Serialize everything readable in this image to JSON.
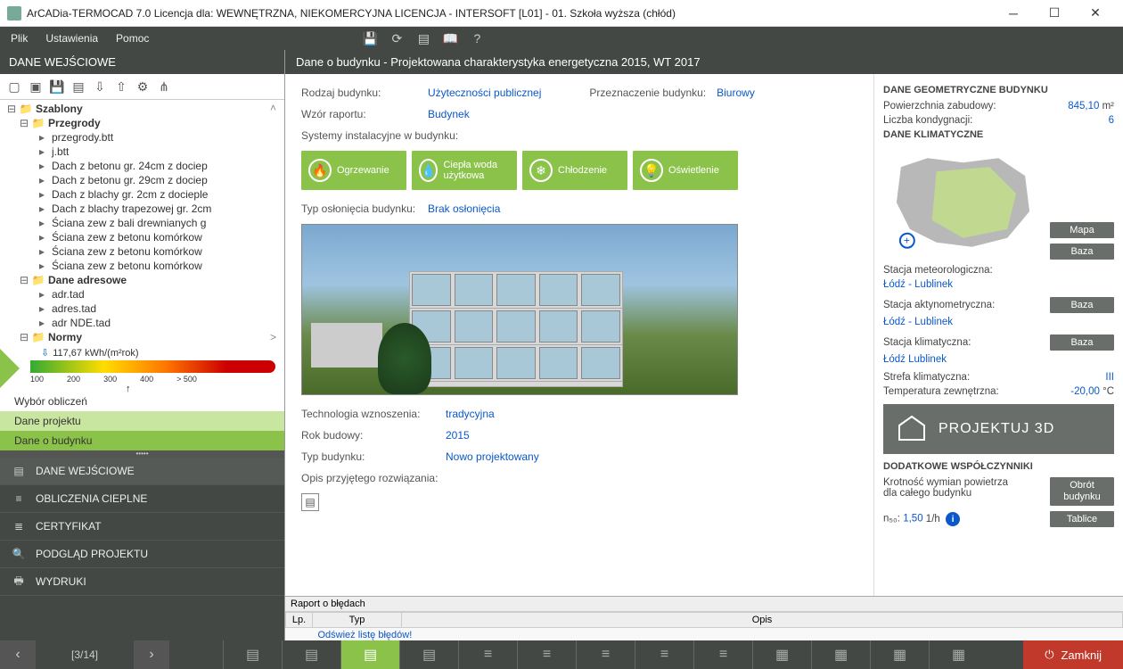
{
  "window": {
    "title": "ArCADia-TERMOCAD 7.0 Licencja dla: WEWNĘTRZNA, NIEKOMERCYJNA LICENCJA - INTERSOFT [L01] - 01. Szkoła wyższa (chłód)"
  },
  "menu": {
    "file": "Plik",
    "settings": "Ustawienia",
    "help": "Pomoc"
  },
  "left": {
    "header": "DANE WEJŚCIOWE",
    "tree": {
      "root": "Szablony",
      "group_przegrody": "Przegrody",
      "items": [
        "przegrody.btt",
        "j.btt",
        "Dach z betonu gr. 24cm z dociep",
        "Dach z betonu gr. 29cm z dociep",
        "Dach z blachy gr. 2cm z docieple",
        "Dach z blachy trapezowej gr. 2cm",
        "Ściana zew z bali drewnianych g",
        "Ściana zew z betonu komórkow",
        "Ściana zew z betonu komórkow",
        "Ściana zew z betonu komórkow"
      ],
      "group_adresowe": "Dane adresowe",
      "adr_items": [
        "adr.tad",
        "adres.tad",
        "adr NDE.tad"
      ],
      "group_normy": "Normy"
    },
    "gauge": {
      "value": "117,67 kWh/(m²rok)",
      "ticks": [
        "100",
        "200",
        "300",
        "400",
        "> 500"
      ],
      "marker": "↑"
    },
    "subtabs": {
      "t1": "Wybór obliczeń",
      "t2": "Dane projektu",
      "t3": "Dane o budynku"
    },
    "modules": {
      "m1": "DANE WEJŚCIOWE",
      "m2": "OBLICZENIA CIEPLNE",
      "m3": "CERTYFIKAT",
      "m4": "PODGLĄD PROJEKTU",
      "m5": "WYDRUKI"
    }
  },
  "content": {
    "header": "Dane o budynku - Projektowana charakterystyka energetyczna 2015, WT 2017",
    "rodzaj_lbl": "Rodzaj budynku:",
    "rodzaj_val": "Użyteczności publicznej",
    "przeznaczenie_lbl": "Przeznaczenie budynku:",
    "przeznaczenie_val": "Biurowy",
    "wzor_lbl": "Wzór raportu:",
    "wzor_val": "Budynek",
    "systemy_lbl": "Systemy instalacyjne w budynku:",
    "systems": {
      "s1": "Ogrzewanie",
      "s2": "Ciepła woda użytkowa",
      "s3": "Chłodzenie",
      "s4": "Oświetlenie"
    },
    "oslon_lbl": "Typ osłonięcia budynku:",
    "oslon_val": "Brak osłonięcia",
    "tech_lbl": "Technologia wznoszenia:",
    "tech_val": "tradycyjna",
    "rok_lbl": "Rok budowy:",
    "rok_val": "2015",
    "typ_lbl": "Typ budynku:",
    "typ_val": "Nowo projektowany",
    "opis_lbl": "Opis przyjętego rozwiązania:"
  },
  "right": {
    "geo_head": "DANE GEOMETRYCZNE BUDYNKU",
    "pow_lbl": "Powierzchnia zabudowy:",
    "pow_val": "845,10",
    "pow_unit": "m²",
    "kond_lbl": "Liczba kondygnacji:",
    "kond_val": "6",
    "klim_head": "DANE KLIMATYCZNE",
    "btn_mapa": "Mapa",
    "btn_baza": "Baza",
    "meteo_lbl": "Stacja meteorologiczna:",
    "meteo_val": "Łódź - Lublinek",
    "aktyn_lbl": "Stacja aktynometryczna:",
    "aktyn_val": "Łódź - Lublinek",
    "klimat_lbl": "Stacja klimatyczna:",
    "klimat_val": "Łódź Lublinek",
    "strefa_lbl": "Strefa klimatyczna:",
    "strefa_val": "III",
    "temp_lbl": "Temperatura zewnętrzna:",
    "temp_val": "-20,00",
    "temp_unit": "°C",
    "proj3d": "PROJEKTUJ 3D",
    "dodat_head": "DODATKOWE WSPÓŁCZYNNIKI",
    "krot_lbl": "Krotność wymian powietrza dla całego budynku",
    "btn_obrot": "Obrót budynku",
    "btn_tablice": "Tablice",
    "n50_lbl": "n₅₀:",
    "n50_val": "1,50",
    "n50_unit": "1/h"
  },
  "errors": {
    "title": "Raport o błędach",
    "col_lp": "Lp.",
    "col_typ": "Typ",
    "col_opis": "Opis",
    "refresh": "Odśwież listę błędów!"
  },
  "bottom": {
    "page": "[3/14]",
    "close": "Zamknij"
  }
}
